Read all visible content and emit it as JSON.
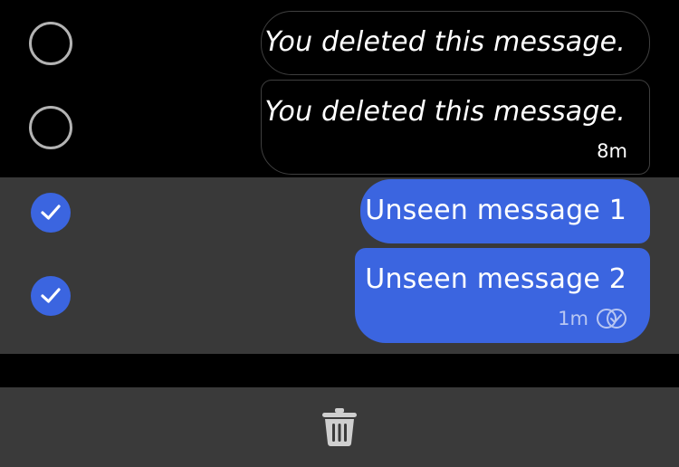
{
  "messages": [
    {
      "text": "You deleted this message.",
      "time": "",
      "deleted": true,
      "selected": false
    },
    {
      "text": "You deleted this message.",
      "time": "8m",
      "deleted": true,
      "selected": false
    },
    {
      "text": "Unseen message 1",
      "time": "",
      "deleted": false,
      "selected": true
    },
    {
      "text": "Unseen message 2",
      "time": "1m",
      "deleted": false,
      "selected": true,
      "status_icon": "double-check-icon"
    }
  ],
  "toolbar": {
    "delete_icon": "trash-icon"
  },
  "colors": {
    "background": "#000000",
    "selected_row": "#393939",
    "bubble_blue": "#3b65e0",
    "bottom_bar": "#3a3a3a",
    "radio_border": "#b3b3b3"
  }
}
